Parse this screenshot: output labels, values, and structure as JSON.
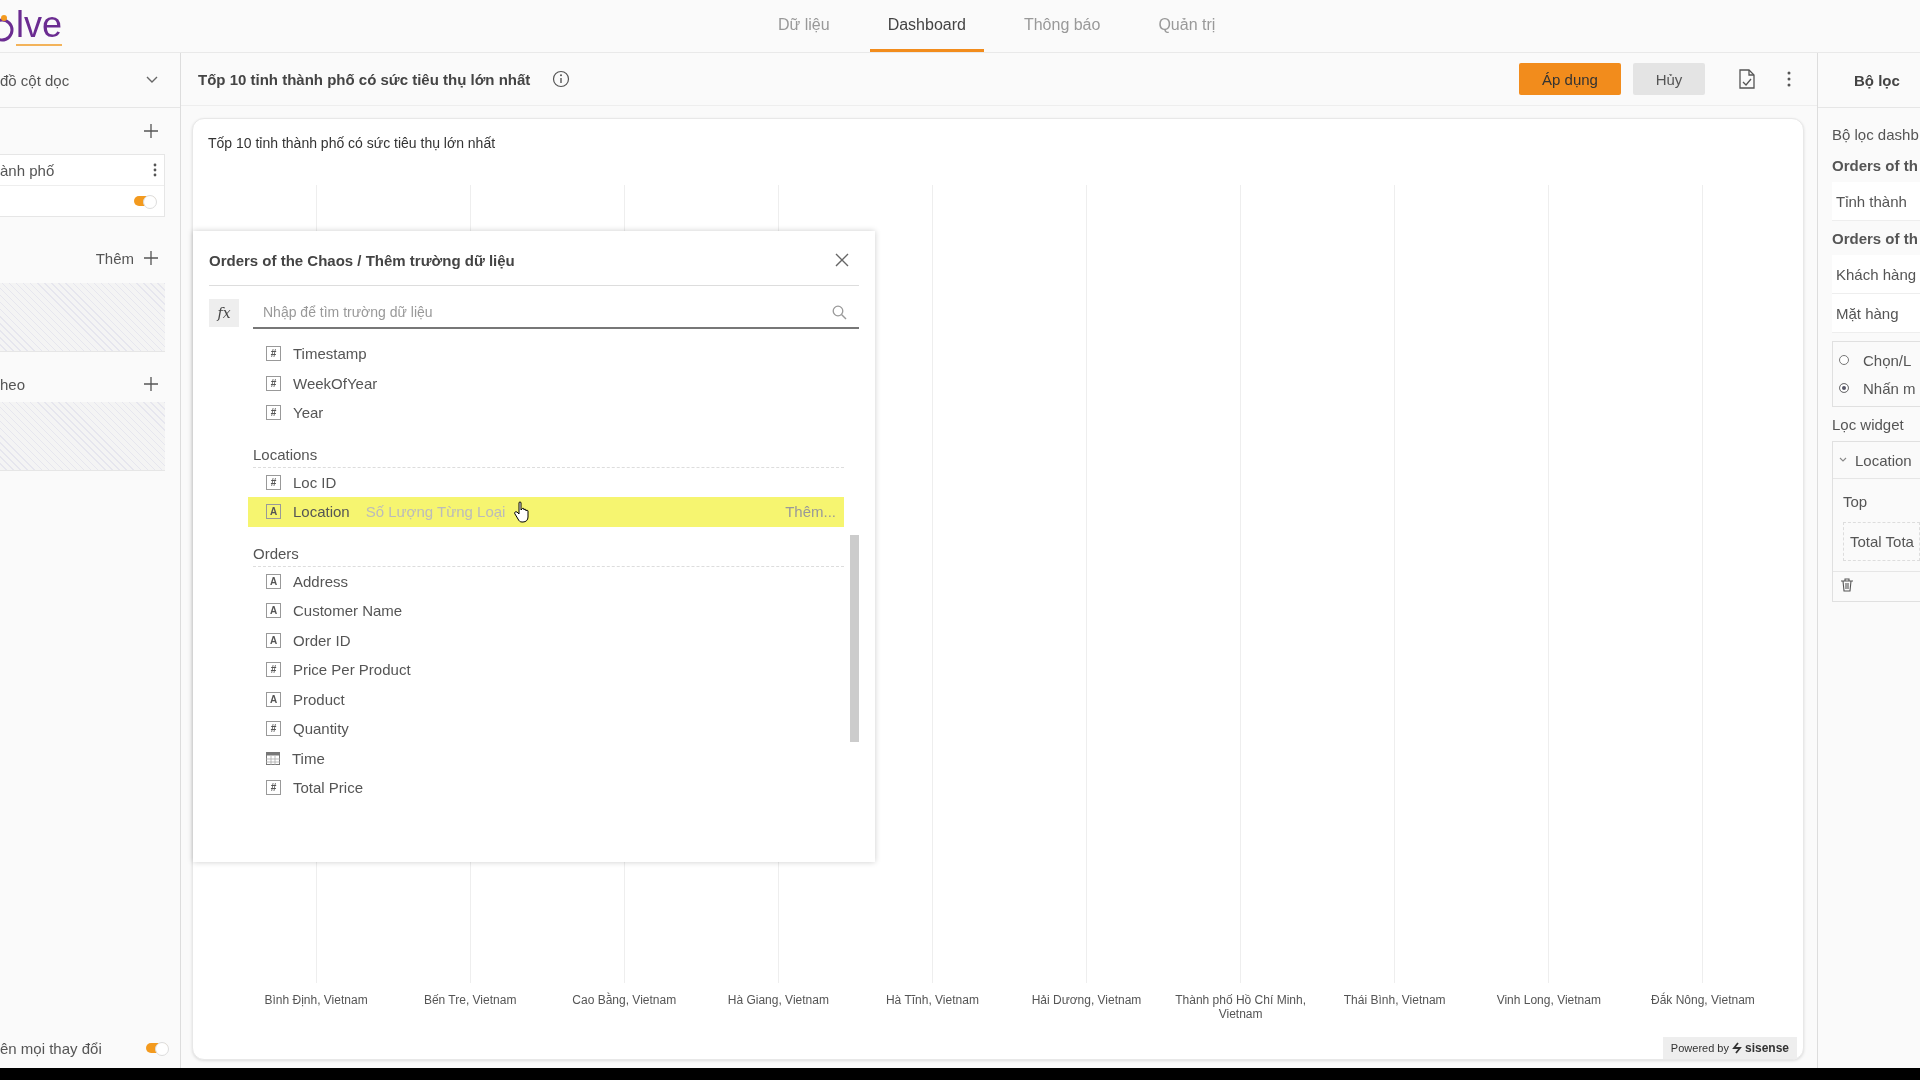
{
  "logo": {
    "text": "lve"
  },
  "nav": [
    {
      "label": "Dữ liệu",
      "selected": false
    },
    {
      "label": "Dashboard",
      "selected": true
    },
    {
      "label": "Thông báo",
      "selected": false
    },
    {
      "label": "Quản trị",
      "selected": false
    }
  ],
  "left_panel": {
    "chart_type": "đồ cột dọc",
    "category_field": "ành phố",
    "category_toggle_on": true,
    "values_action": "Thêm",
    "break_by_label": "heo",
    "auto_update_label": "ên mọi thay đổi",
    "auto_update_on": true
  },
  "header": {
    "title": "Tốp 10 tỉnh thành phố có sức tiêu thụ lớn nhất",
    "buttons": [
      {
        "label": "Áp dụng",
        "kind": "primary"
      },
      {
        "label": "Hủy",
        "kind": "secondary"
      }
    ]
  },
  "widget": {
    "title": "Tốp 10 tỉnh thành phố có sức tiêu thụ lớn nhất",
    "x_labels": [
      "Bình Định, Vietnam",
      "Bến Tre, Vietnam",
      "Cao Bằng, Vietnam",
      "Hà Giang, Vietnam",
      "Hà Tĩnh, Vietnam",
      "Hải Dương, Vietnam",
      "Thành phố Hồ Chí Minh, Vietnam",
      "Thái Bình, Vietnam",
      "Vinh Long, Vietnam",
      "Đắk Nông, Vietnam"
    ],
    "powered_by": "Powered by",
    "brand": "sisense"
  },
  "dialog": {
    "title": "Orders of the Chaos / Thêm trường dữ liệu",
    "search_placeholder": "Nhập để tìm trường dữ liệu",
    "fx": "fx",
    "groups": [
      {
        "fields": [
          {
            "name": "Timestamp",
            "kind": "number",
            "icon": "#",
            "selected": false
          },
          {
            "name": "WeekOfYear",
            "kind": "number",
            "icon": "#",
            "selected": false
          },
          {
            "name": "Year",
            "kind": "number",
            "icon": "#",
            "selected": false
          }
        ]
      },
      {
        "name": "Locations",
        "fields": [
          {
            "name": "Loc ID",
            "kind": "number",
            "icon": "#",
            "selected": false
          },
          {
            "name": "Location",
            "kind": "text",
            "icon": "A",
            "selected": true,
            "hint": "Số Lượng Từng Loại",
            "action": "Thêm..."
          }
        ]
      },
      {
        "name": "Orders",
        "fields": [
          {
            "name": "Address",
            "kind": "text",
            "icon": "A",
            "selected": false
          },
          {
            "name": "Customer Name",
            "kind": "text",
            "icon": "A",
            "selected": false
          },
          {
            "name": "Order ID",
            "kind": "text",
            "icon": "A",
            "selected": false
          },
          {
            "name": "Price Per Product",
            "kind": "number",
            "icon": "#",
            "selected": false
          },
          {
            "name": "Product",
            "kind": "text",
            "icon": "A",
            "selected": false
          },
          {
            "name": "Quantity",
            "kind": "number",
            "icon": "#",
            "selected": false
          },
          {
            "name": "Time",
            "kind": "date",
            "selected": false
          },
          {
            "name": "Total Price",
            "kind": "number",
            "icon": "#",
            "selected": false
          }
        ]
      }
    ]
  },
  "right_panel": {
    "title": "Bộ lọc",
    "section": "Bộ lọc dashb",
    "items": [
      {
        "kind": "heading",
        "text": "Orders of th"
      },
      {
        "kind": "filter",
        "text": "Tỉnh thành"
      },
      {
        "kind": "heading",
        "text": "Orders of th"
      },
      {
        "kind": "filter",
        "text": "Khách hàng"
      },
      {
        "kind": "filter",
        "text": "Mặt hàng"
      }
    ],
    "radios": [
      {
        "label": "Chọn/L",
        "selected": false
      },
      {
        "label": "Nhấn m",
        "selected": true
      }
    ],
    "widget_filters_label": "Lọc widget",
    "widget_filter": {
      "field": "Location",
      "expanded": true,
      "mode": "Top",
      "measure": "Total Tota"
    }
  }
}
